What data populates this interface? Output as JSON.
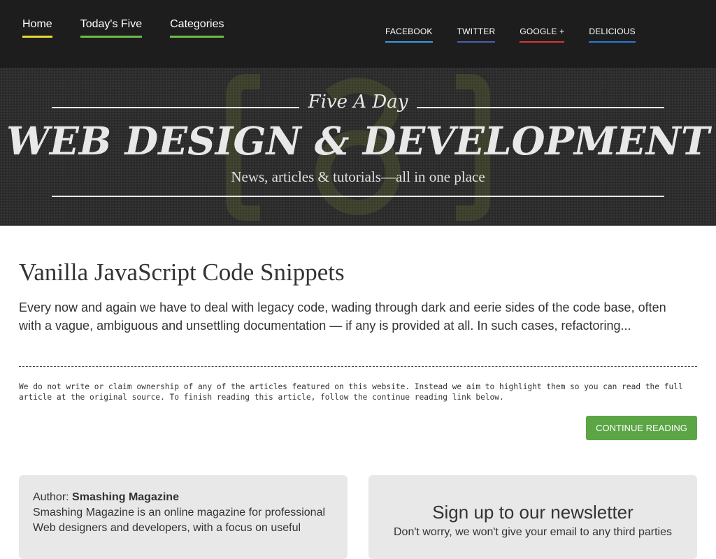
{
  "nav": {
    "main": [
      "Home",
      "Today's Five",
      "Categories"
    ],
    "social": [
      "FACEBOOK",
      "TWITTER",
      "GOOGLE +",
      "DELICIOUS"
    ]
  },
  "hero": {
    "tagline": "Five A Day",
    "title": "WEB DESIGN & DEVELOPMENT",
    "subtitle": "News, articles & tutorials—all in one place"
  },
  "article": {
    "title": "Vanilla JavaScript Code Snippets",
    "excerpt": "Every now and again we have to deal with legacy code, wading through dark and eerie sides of the code base, often with a vague, ambiguous and unsettling documentation — if any is provided at all. In such cases, refactoring...",
    "disclaimer": "We do not write or claim ownership of any of the articles featured on this website. Instead we aim to highlight them so you can read the full article at the original source. To finish reading this article, follow the continue reading link below.",
    "continue_label": "CONTINUE READING"
  },
  "author": {
    "label": "Author:",
    "name": "Smashing Magazine",
    "bio": "Smashing Magazine is an online magazine for professional Web designers and developers, with a focus on useful"
  },
  "newsletter": {
    "title": "Sign up to our newsletter",
    "subtitle": "Don't worry, we won't give your email to any third parties"
  },
  "colors": {
    "topbar": "#1d1d1d",
    "accent_green": "#5ba545",
    "home_underline": "#e8d83a",
    "facebook": "#3b9ae0",
    "twitter": "#4b5fa9",
    "google": "#d23a36",
    "delicious": "#2b78d4"
  }
}
